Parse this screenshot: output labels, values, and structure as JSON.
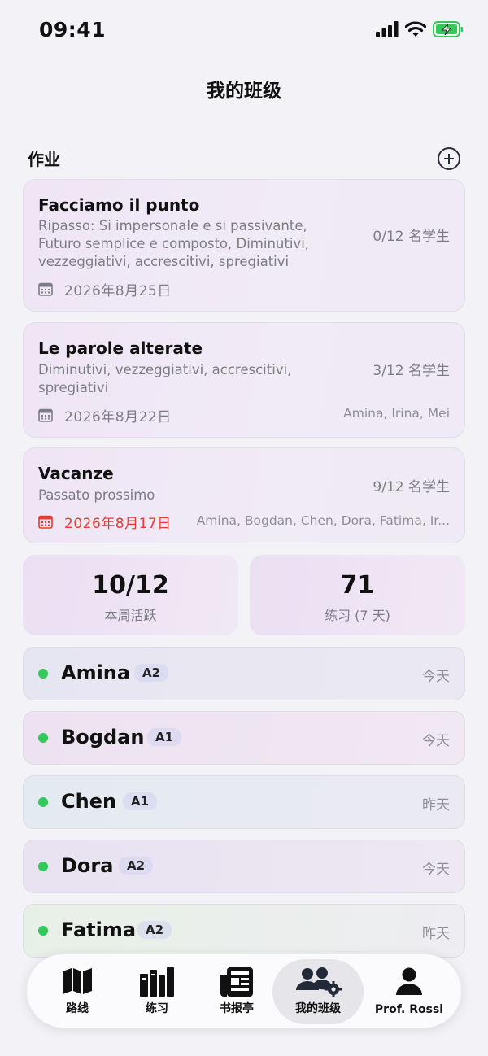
{
  "status": {
    "time": "09:41"
  },
  "page": {
    "title": "我的班级"
  },
  "homework": {
    "section_title": "作业",
    "items": [
      {
        "title": "Facciamo il punto",
        "description": "Ripasso: Si impersonale e si passivante, Futuro semplice e composto, Diminutivi, vezzeggiativi, accrescitivi, spregiativi",
        "count": "0/12 名学生",
        "date": "2026年8月25日",
        "students": ""
      },
      {
        "title": "Le parole alterate",
        "description": "Diminutivi, vezzeggiativi, accrescitivi, spregiativi",
        "count": "3/12 名学生",
        "date": "2026年8月22日",
        "students": "Amina, Irina, Mei"
      },
      {
        "title": "Vacanze",
        "description": "Passato prossimo",
        "count": "9/12 名学生",
        "date": "2026年8月17日",
        "students": "Amina, Bogdan, Chen, Dora, Fatima, Ir...",
        "overdue": true
      }
    ]
  },
  "stats": [
    {
      "value": "10/12",
      "label": "本周活跃"
    },
    {
      "value": "71",
      "label": "练习 (7 天)"
    }
  ],
  "students": [
    {
      "name": "Amina",
      "level": "A2",
      "last_seen": "今天"
    },
    {
      "name": "Bogdan",
      "level": "A1",
      "last_seen": "今天"
    },
    {
      "name": "Chen",
      "level": "A1",
      "last_seen": "昨天"
    },
    {
      "name": "Dora",
      "level": "A2",
      "last_seen": "今天"
    },
    {
      "name": "Fatima",
      "level": "A2",
      "last_seen": "昨天"
    }
  ],
  "tabs": [
    {
      "label": "路线",
      "icon": "map-icon"
    },
    {
      "label": "练习",
      "icon": "books-icon"
    },
    {
      "label": "书报亭",
      "icon": "newspaper-icon"
    },
    {
      "label": "我的班级",
      "icon": "class-settings-icon",
      "active": true
    },
    {
      "label": "Prof. Rossi",
      "icon": "person-icon"
    }
  ],
  "colors": {
    "active_dot": "#34c759",
    "overdue": "#ea3b32",
    "secondary_text": "#7c7c84"
  }
}
